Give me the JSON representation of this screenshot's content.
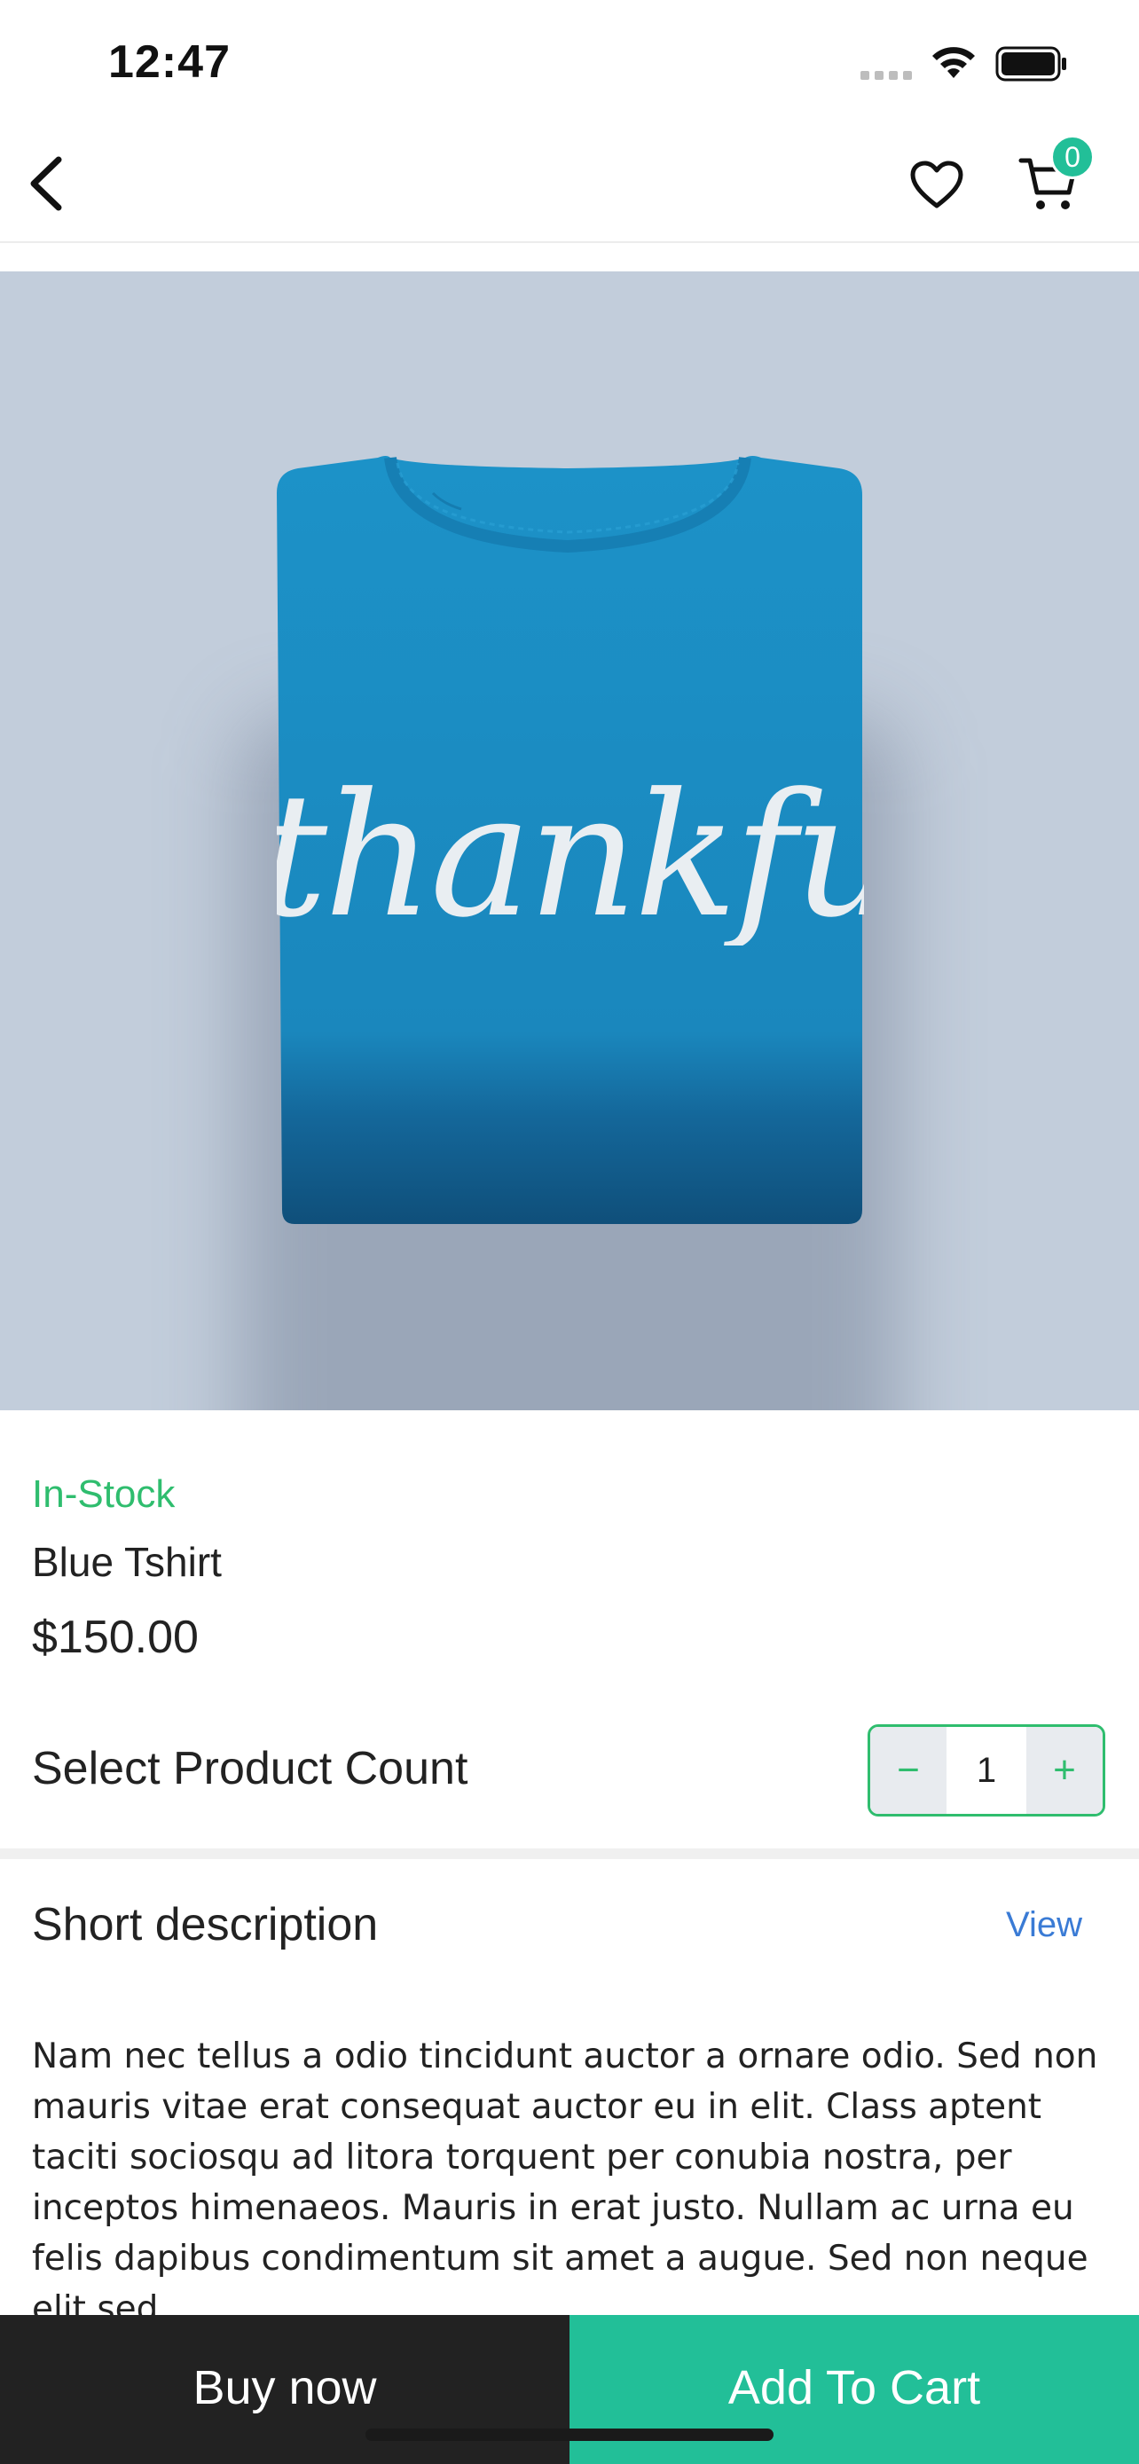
{
  "status_bar": {
    "time": "12:47",
    "signal_icon": "cellular-signal-icon",
    "wifi_icon": "wifi-icon",
    "battery_icon": "battery-icon"
  },
  "nav": {
    "back_icon": "chevron-left-icon",
    "wishlist_icon": "heart-icon",
    "cart_icon": "cart-icon",
    "cart_count": "0"
  },
  "product": {
    "image_print_text": "thankful",
    "stock_status": "In-Stock",
    "name": "Blue Tshirt",
    "price": "$150.00"
  },
  "count": {
    "label": "Select Product Count",
    "minus": "−",
    "value": "1",
    "plus": "+"
  },
  "description": {
    "title": "Short description",
    "view_label": "View",
    "body": "Nam nec tellus a odio tincidunt auctor a ornare odio. Sed non mauris vitae erat consequat auctor eu in elit. Class aptent taciti sociosqu ad litora torquent per conubia nostra, per inceptos himenaeos. Mauris in erat justo. Nullam ac urna eu felis dapibus condimentum sit amet a augue. Sed non neque elit sed"
  },
  "actions": {
    "buy_now": "Buy now",
    "add_to_cart": "Add To Cart"
  },
  "colors": {
    "accent": "#22bf98",
    "stock_green": "#2fbd6e",
    "link_blue": "#3a7bd5",
    "dark": "#222222",
    "image_background": "#c2cddb",
    "shirt_blue": "#1e8fc4"
  }
}
